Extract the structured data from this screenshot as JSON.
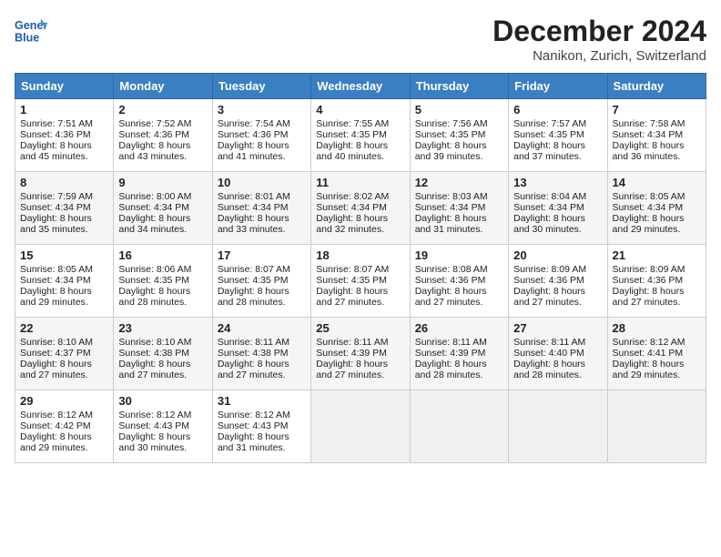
{
  "header": {
    "logo_general": "General",
    "logo_blue": "Blue",
    "month": "December 2024",
    "location": "Nanikon, Zurich, Switzerland"
  },
  "days_of_week": [
    "Sunday",
    "Monday",
    "Tuesday",
    "Wednesday",
    "Thursday",
    "Friday",
    "Saturday"
  ],
  "weeks": [
    [
      {
        "day": "1",
        "sunrise": "Sunrise: 7:51 AM",
        "sunset": "Sunset: 4:36 PM",
        "daylight": "Daylight: 8 hours and 45 minutes."
      },
      {
        "day": "2",
        "sunrise": "Sunrise: 7:52 AM",
        "sunset": "Sunset: 4:36 PM",
        "daylight": "Daylight: 8 hours and 43 minutes."
      },
      {
        "day": "3",
        "sunrise": "Sunrise: 7:54 AM",
        "sunset": "Sunset: 4:36 PM",
        "daylight": "Daylight: 8 hours and 41 minutes."
      },
      {
        "day": "4",
        "sunrise": "Sunrise: 7:55 AM",
        "sunset": "Sunset: 4:35 PM",
        "daylight": "Daylight: 8 hours and 40 minutes."
      },
      {
        "day": "5",
        "sunrise": "Sunrise: 7:56 AM",
        "sunset": "Sunset: 4:35 PM",
        "daylight": "Daylight: 8 hours and 39 minutes."
      },
      {
        "day": "6",
        "sunrise": "Sunrise: 7:57 AM",
        "sunset": "Sunset: 4:35 PM",
        "daylight": "Daylight: 8 hours and 37 minutes."
      },
      {
        "day": "7",
        "sunrise": "Sunrise: 7:58 AM",
        "sunset": "Sunset: 4:34 PM",
        "daylight": "Daylight: 8 hours and 36 minutes."
      }
    ],
    [
      {
        "day": "8",
        "sunrise": "Sunrise: 7:59 AM",
        "sunset": "Sunset: 4:34 PM",
        "daylight": "Daylight: 8 hours and 35 minutes."
      },
      {
        "day": "9",
        "sunrise": "Sunrise: 8:00 AM",
        "sunset": "Sunset: 4:34 PM",
        "daylight": "Daylight: 8 hours and 34 minutes."
      },
      {
        "day": "10",
        "sunrise": "Sunrise: 8:01 AM",
        "sunset": "Sunset: 4:34 PM",
        "daylight": "Daylight: 8 hours and 33 minutes."
      },
      {
        "day": "11",
        "sunrise": "Sunrise: 8:02 AM",
        "sunset": "Sunset: 4:34 PM",
        "daylight": "Daylight: 8 hours and 32 minutes."
      },
      {
        "day": "12",
        "sunrise": "Sunrise: 8:03 AM",
        "sunset": "Sunset: 4:34 PM",
        "daylight": "Daylight: 8 hours and 31 minutes."
      },
      {
        "day": "13",
        "sunrise": "Sunrise: 8:04 AM",
        "sunset": "Sunset: 4:34 PM",
        "daylight": "Daylight: 8 hours and 30 minutes."
      },
      {
        "day": "14",
        "sunrise": "Sunrise: 8:05 AM",
        "sunset": "Sunset: 4:34 PM",
        "daylight": "Daylight: 8 hours and 29 minutes."
      }
    ],
    [
      {
        "day": "15",
        "sunrise": "Sunrise: 8:05 AM",
        "sunset": "Sunset: 4:34 PM",
        "daylight": "Daylight: 8 hours and 29 minutes."
      },
      {
        "day": "16",
        "sunrise": "Sunrise: 8:06 AM",
        "sunset": "Sunset: 4:35 PM",
        "daylight": "Daylight: 8 hours and 28 minutes."
      },
      {
        "day": "17",
        "sunrise": "Sunrise: 8:07 AM",
        "sunset": "Sunset: 4:35 PM",
        "daylight": "Daylight: 8 hours and 28 minutes."
      },
      {
        "day": "18",
        "sunrise": "Sunrise: 8:07 AM",
        "sunset": "Sunset: 4:35 PM",
        "daylight": "Daylight: 8 hours and 27 minutes."
      },
      {
        "day": "19",
        "sunrise": "Sunrise: 8:08 AM",
        "sunset": "Sunset: 4:36 PM",
        "daylight": "Daylight: 8 hours and 27 minutes."
      },
      {
        "day": "20",
        "sunrise": "Sunrise: 8:09 AM",
        "sunset": "Sunset: 4:36 PM",
        "daylight": "Daylight: 8 hours and 27 minutes."
      },
      {
        "day": "21",
        "sunrise": "Sunrise: 8:09 AM",
        "sunset": "Sunset: 4:36 PM",
        "daylight": "Daylight: 8 hours and 27 minutes."
      }
    ],
    [
      {
        "day": "22",
        "sunrise": "Sunrise: 8:10 AM",
        "sunset": "Sunset: 4:37 PM",
        "daylight": "Daylight: 8 hours and 27 minutes."
      },
      {
        "day": "23",
        "sunrise": "Sunrise: 8:10 AM",
        "sunset": "Sunset: 4:38 PM",
        "daylight": "Daylight: 8 hours and 27 minutes."
      },
      {
        "day": "24",
        "sunrise": "Sunrise: 8:11 AM",
        "sunset": "Sunset: 4:38 PM",
        "daylight": "Daylight: 8 hours and 27 minutes."
      },
      {
        "day": "25",
        "sunrise": "Sunrise: 8:11 AM",
        "sunset": "Sunset: 4:39 PM",
        "daylight": "Daylight: 8 hours and 27 minutes."
      },
      {
        "day": "26",
        "sunrise": "Sunrise: 8:11 AM",
        "sunset": "Sunset: 4:39 PM",
        "daylight": "Daylight: 8 hours and 28 minutes."
      },
      {
        "day": "27",
        "sunrise": "Sunrise: 8:11 AM",
        "sunset": "Sunset: 4:40 PM",
        "daylight": "Daylight: 8 hours and 28 minutes."
      },
      {
        "day": "28",
        "sunrise": "Sunrise: 8:12 AM",
        "sunset": "Sunset: 4:41 PM",
        "daylight": "Daylight: 8 hours and 29 minutes."
      }
    ],
    [
      {
        "day": "29",
        "sunrise": "Sunrise: 8:12 AM",
        "sunset": "Sunset: 4:42 PM",
        "daylight": "Daylight: 8 hours and 29 minutes."
      },
      {
        "day": "30",
        "sunrise": "Sunrise: 8:12 AM",
        "sunset": "Sunset: 4:43 PM",
        "daylight": "Daylight: 8 hours and 30 minutes."
      },
      {
        "day": "31",
        "sunrise": "Sunrise: 8:12 AM",
        "sunset": "Sunset: 4:43 PM",
        "daylight": "Daylight: 8 hours and 31 minutes."
      },
      null,
      null,
      null,
      null
    ]
  ]
}
